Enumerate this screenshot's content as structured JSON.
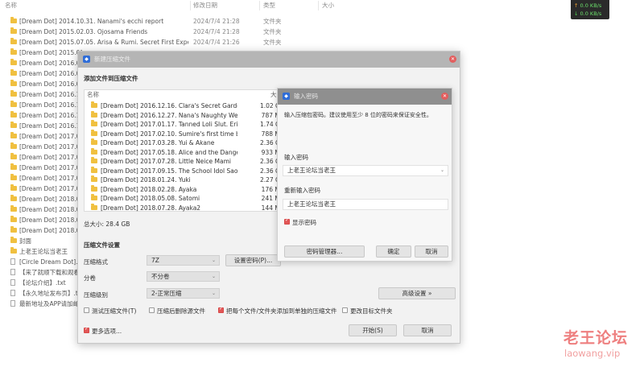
{
  "explorer": {
    "headers": {
      "name": "名称",
      "date": "修改日期",
      "type": "类型",
      "size": "大小"
    },
    "rows": [
      {
        "icon": "folder-icon",
        "name": "[Dream Dot] 2014.10.31. Nanami's ecchi report",
        "date": "2024/7/4 21:28",
        "type": "文件夹"
      },
      {
        "icon": "folder-icon",
        "name": "[Dream Dot] 2015.02.03. Ojosama Friends",
        "date": "2024/7/4 21:28",
        "type": "文件夹"
      },
      {
        "icon": "folder-icon",
        "name": "[Dream Dot] 2015.07.05. Arisa & Rumi. Secret First Experi...",
        "date": "2024/7/4 21:26",
        "type": "文件夹"
      },
      {
        "icon": "folder-icon",
        "name": "[Dream Dot] 2015.09",
        "date": "",
        "type": ""
      },
      {
        "icon": "folder-icon",
        "name": "[Dream Dot] 2016.07",
        "date": "",
        "type": ""
      },
      {
        "icon": "folder-icon",
        "name": "[Dream Dot] 2016.04",
        "date": "",
        "type": ""
      },
      {
        "icon": "folder-icon",
        "name": "[Dream Dot] 2016.08",
        "date": "",
        "type": ""
      },
      {
        "icon": "folder-icon",
        "name": "[Dream Dot] 2016.11",
        "date": "",
        "type": ""
      },
      {
        "icon": "folder-icon",
        "name": "[Dream Dot] 2016.11",
        "date": "",
        "type": ""
      },
      {
        "icon": "folder-icon",
        "name": "[Dream Dot] 2016.12",
        "date": "",
        "type": ""
      },
      {
        "icon": "folder-icon",
        "name": "[Dream Dot] 2016.12",
        "date": "",
        "type": ""
      },
      {
        "icon": "folder-icon",
        "name": "[Dream Dot] 2017.01",
        "date": "",
        "type": ""
      },
      {
        "icon": "folder-icon",
        "name": "[Dream Dot] 2017.02",
        "date": "",
        "type": ""
      },
      {
        "icon": "folder-icon",
        "name": "[Dream Dot] 2017.03",
        "date": "",
        "type": ""
      },
      {
        "icon": "folder-icon",
        "name": "[Dream Dot] 2017.05",
        "date": "",
        "type": ""
      },
      {
        "icon": "folder-icon",
        "name": "[Dream Dot] 2017.07",
        "date": "",
        "type": ""
      },
      {
        "icon": "folder-icon",
        "name": "[Dream Dot] 2017.09",
        "date": "",
        "type": ""
      },
      {
        "icon": "folder-icon",
        "name": "[Dream Dot] 2018.01",
        "date": "",
        "type": ""
      },
      {
        "icon": "folder-icon",
        "name": "[Dream Dot] 2018.02",
        "date": "",
        "type": ""
      },
      {
        "icon": "folder-icon",
        "name": "[Dream Dot] 2018.05",
        "date": "",
        "type": ""
      },
      {
        "icon": "folder-icon",
        "name": "[Dream Dot] 2018.07",
        "date": "",
        "type": ""
      },
      {
        "icon": "folder-icon",
        "name": "封面",
        "date": "",
        "type": ""
      },
      {
        "icon": "folder-icon",
        "name": "上老王论坛当老王",
        "date": "",
        "type": ""
      },
      {
        "icon": "file-icon",
        "name": "[Circle Dream Dot].pi",
        "date": "",
        "type": ""
      },
      {
        "icon": "file-icon",
        "name": "【来了就顺下载和观看",
        "date": "",
        "type": ""
      },
      {
        "icon": "file-icon",
        "name": "【论坛介绍】.txt",
        "date": "",
        "type": ""
      },
      {
        "icon": "file-icon",
        "name": "【永久地址发布页】.txt",
        "date": "",
        "type": ""
      },
      {
        "icon": "file-icon",
        "name": "最新地址及APP请加邮",
        "date": "",
        "type": ""
      }
    ]
  },
  "netspeed": {
    "up": "0.0 KB/s",
    "down": "0.0 KB/s"
  },
  "dialog": {
    "title": "新建压缩文件",
    "add_files_title": "添加文件到压缩文件",
    "list_headers": {
      "name": "名称",
      "size": "大小"
    },
    "files": [
      {
        "name": "[Dream Dot] 2016.12.16. Clara's Secret Garden",
        "size": "1.02 GB"
      },
      {
        "name": "[Dream Dot] 2016.12.27. Nana's Naughty Wet",
        "size": "787 MB"
      },
      {
        "name": "[Dream Dot] 2017.01.17. Tanned Loli Slut. Erik...",
        "size": "1.74 GB"
      },
      {
        "name": "[Dream Dot] 2017.02.10. Sumire's first time be...",
        "size": "788 MB"
      },
      {
        "name": "[Dream Dot] 2017.03.28. Yui & Akane",
        "size": "2.36 GB"
      },
      {
        "name": "[Dream Dot] 2017.05.18. Alice and the Danger...",
        "size": "933 MB"
      },
      {
        "name": "[Dream Dot] 2017.07.28. Little Neice Mami",
        "size": "2.36 GB"
      },
      {
        "name": "[Dream Dot] 2017.09.15. The School Idol Saor...",
        "size": "2.36 GB"
      },
      {
        "name": "[Dream Dot] 2018.01.24. Yuki",
        "size": "2.27 GB"
      },
      {
        "name": "[Dream Dot] 2018.02.28. Ayaka",
        "size": "176 MB"
      },
      {
        "name": "[Dream Dot] 2018.05.08. Satomi",
        "size": "241 MB"
      },
      {
        "name": "[Dream Dot] 2018.07.28. Ayaka2",
        "size": "144 MB"
      }
    ],
    "total_size": "总大小: 28.4 GB",
    "settings_title": "压缩文件设置",
    "format_label": "压缩格式",
    "format_value": "7Z",
    "split_label": "分卷",
    "split_value": "不分卷",
    "level_label": "压缩级别",
    "level_value": "2-正常压缩",
    "set_password_button": "设置密码(P)...",
    "advanced_button": "高级设置 »",
    "checkboxes": {
      "test": {
        "label": "测试压缩文件(T)",
        "checked": false
      },
      "delete": {
        "label": "压缩后删除源文件",
        "checked": false
      },
      "separate": {
        "label": "把每个文件/文件夹添加到单独的压缩文件",
        "checked": true
      },
      "modify": {
        "label": "更改目标文件夹",
        "checked": false
      },
      "more": {
        "label": "更多选项...",
        "checked": true
      }
    },
    "start_button": "开始(S)",
    "cancel_button": "取消"
  },
  "password_dialog": {
    "title": "输入密码",
    "instruction": "输入压缩包密码。建议使用至少 8 位的密码来保证安全性。",
    "enter_label": "输入密码",
    "enter_value": "上老王论坛当老王",
    "reenter_label": "重新输入密码",
    "reenter_value": "上老王论坛当老王",
    "show_password_label": "显示密码",
    "show_password_checked": true,
    "manager_button": "密码管理器...",
    "ok_button": "确定",
    "cancel_button": "取消"
  },
  "watermark": {
    "cn": "老王论坛",
    "url": "laowang.vip"
  },
  "colors": {
    "accent_red": "#e25757",
    "folder": "#f0c040",
    "titlebar": "#b5b5b5",
    "logo_blue": "#2f6dd8"
  }
}
